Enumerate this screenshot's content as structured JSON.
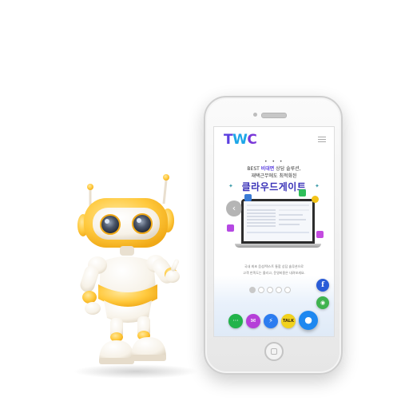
{
  "logo": {
    "part1": "T",
    "part2": "W",
    "part3": "C"
  },
  "header": {
    "menu_icon": "hamburger-menu-icon"
  },
  "hero": {
    "dots": "• • •",
    "tagline_prefix": "BEST ",
    "tagline_bold": "비대면",
    "tagline_suffix": " 상담 솔루션,",
    "tagline2": "재택근무에도 최적화된",
    "headline": "클라우드게이트",
    "desc1": "국내 최초 음성/텍스트 통합 상담 솔루션으로",
    "desc2": "고객 만족도는 올리고, 운영비용은 내려보세요."
  },
  "carousel": {
    "prev_symbol": "‹",
    "dots": [
      true,
      false,
      false,
      false,
      false
    ]
  },
  "side_buttons": {
    "facebook": "f",
    "share": "◉"
  },
  "bottom_bar": {
    "chat": "···",
    "message": "✉",
    "messenger": "⚡",
    "talk": "TALK",
    "main": "●"
  },
  "colors": {
    "brand_purple": "#5b3fe0",
    "brand_blue": "#1ea7e8",
    "headline": "#3a32b8",
    "facebook": "#2a5cd7",
    "kakao": "#f1d21e"
  }
}
